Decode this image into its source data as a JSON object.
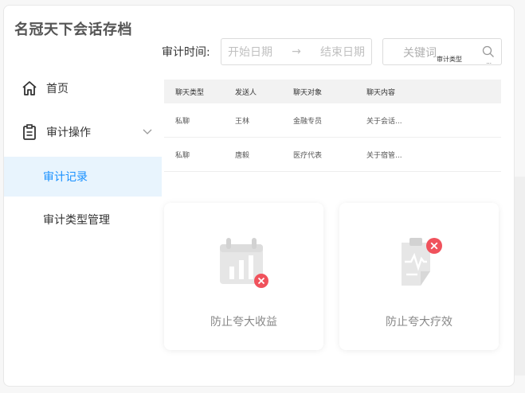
{
  "app": {
    "title": "名冠天下会话存档"
  },
  "sidebar": {
    "items": [
      {
        "label": "首页",
        "icon": "home-icon"
      },
      {
        "label": "审计操作",
        "icon": "clipboard-icon"
      },
      {
        "label": "审计记录",
        "active": true
      },
      {
        "label": "审计类型管理"
      }
    ]
  },
  "toolbar": {
    "time_label": "审计时间:",
    "date_start_placeholder": "开始日期",
    "date_arrow": "→",
    "date_end_placeholder": "结束日期",
    "keyword_placeholder": "关键词",
    "keyword_type": "审计类型",
    "keyword_dots": "..."
  },
  "table": {
    "columns": [
      "聊天类型",
      "发送人",
      "聊天对象",
      "聊天内容"
    ],
    "rows": [
      [
        "私聊",
        "王林",
        "金融专员",
        "关于会话..."
      ],
      [
        "私聊",
        "唐毅",
        "医疗代表",
        "关于宿管..."
      ]
    ]
  },
  "cards": [
    {
      "label": "防止夸大收益",
      "icon": "chart-calendar-icon"
    },
    {
      "label": "防止夸大疗效",
      "icon": "medical-clipboard-icon"
    }
  ],
  "colors": {
    "accent": "#1890ff",
    "active_bg": "#e8f4fd",
    "badge_red": "#f0525c",
    "icon_gray": "#dcdcdc"
  }
}
